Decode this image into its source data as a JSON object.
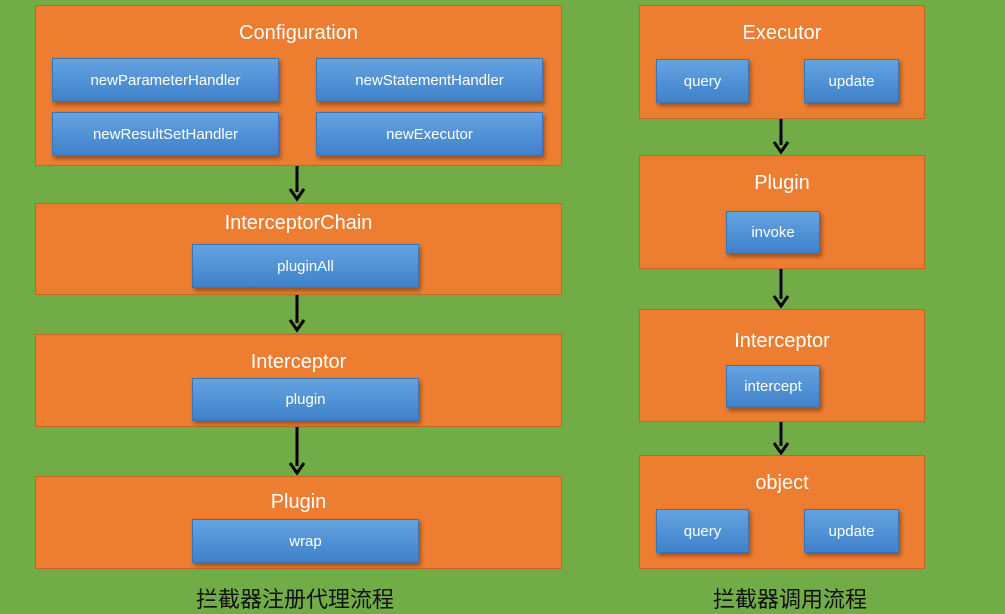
{
  "left_flow": {
    "caption": "拦截器注册代理流程",
    "configuration": {
      "title": "Configuration",
      "methods": [
        "newParameterHandler",
        "newStatementHandler",
        "newResultSetHandler",
        "newExecutor"
      ]
    },
    "interceptor_chain": {
      "title": "InterceptorChain",
      "method": "pluginAll"
    },
    "interceptor": {
      "title": "Interceptor",
      "method": "plugin"
    },
    "plugin": {
      "title": "Plugin",
      "method": "wrap"
    }
  },
  "right_flow": {
    "caption": "拦截器调用流程",
    "executor": {
      "title": "Executor",
      "methods": [
        "query",
        "update"
      ]
    },
    "plugin": {
      "title": "Plugin",
      "method": "invoke"
    },
    "interceptor": {
      "title": "Interceptor",
      "method": "intercept"
    },
    "object": {
      "title": "object",
      "methods": [
        "query",
        "update"
      ]
    }
  },
  "colors": {
    "background": "#72ac47",
    "box": "#ed7d31",
    "method_pill": "#4a8cd3",
    "arrow": "#000000"
  }
}
